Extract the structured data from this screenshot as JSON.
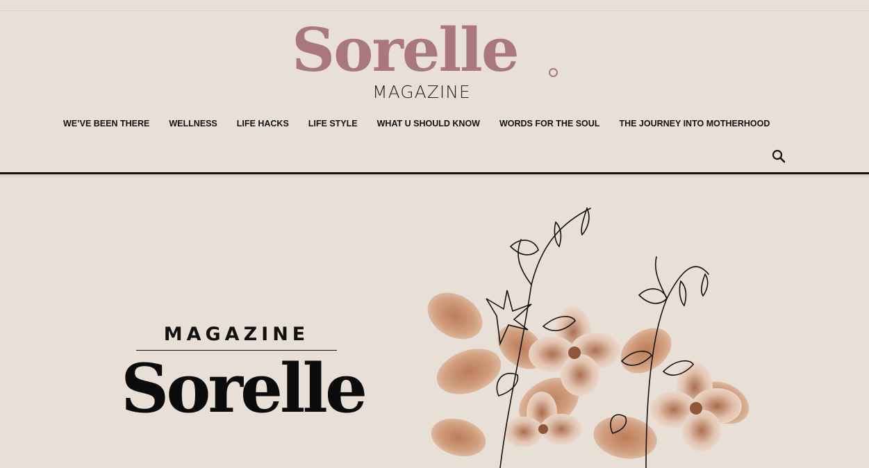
{
  "brand": {
    "logo_word": "Sorelle",
    "logo_sub": "MAGAZINE",
    "accent_color": "#a9787c"
  },
  "nav": {
    "items": [
      "WE’VE BEEN THERE",
      "WELLNESS",
      "LIFE HACKS",
      "LIFE STYLE",
      "WHAT U SHOULD KNOW",
      "WORDS FOR THE SOUL",
      "THE JOURNEY INTO MOTHERHOOD"
    ],
    "search_icon": "search-icon"
  },
  "hero": {
    "kicker": "MAGAZINE",
    "title": "Sorelle",
    "illustration": "floral-watercolor-illustration"
  }
}
